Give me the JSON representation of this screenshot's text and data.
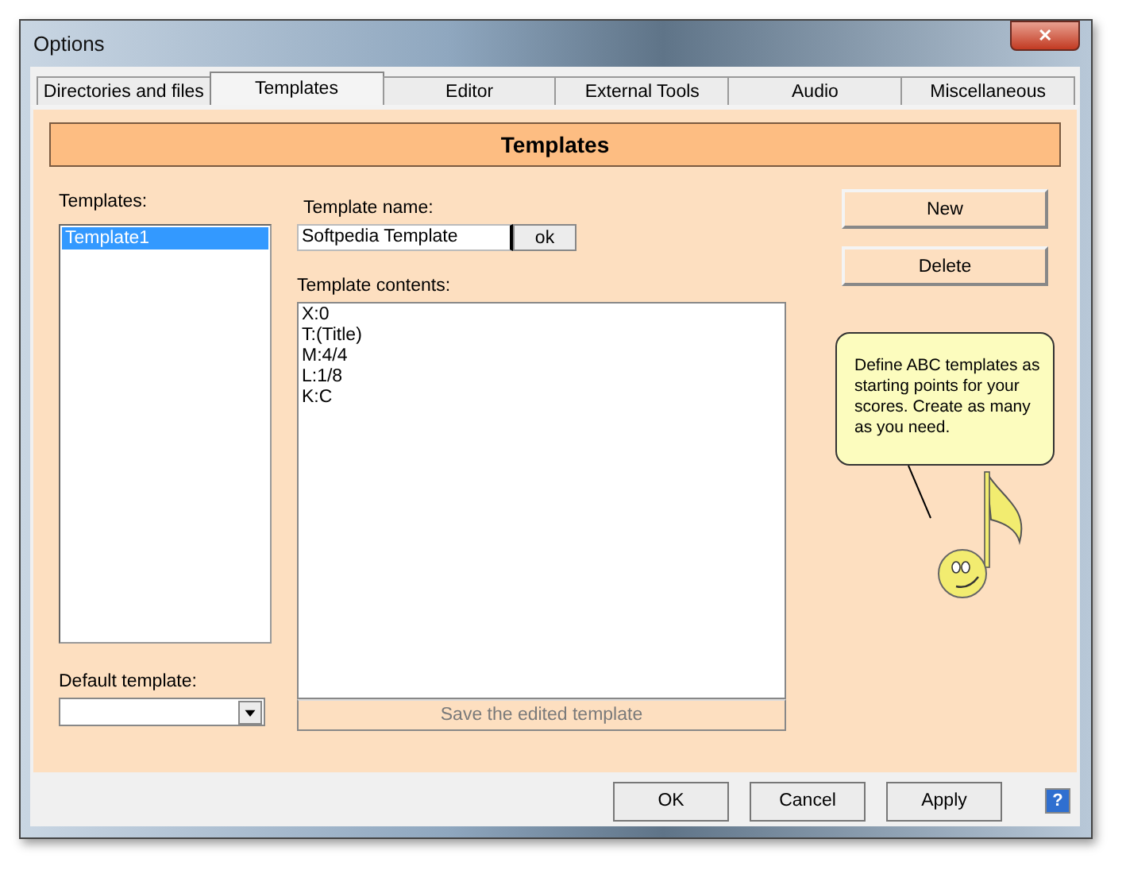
{
  "window": {
    "title": "Options",
    "close_label": "✕"
  },
  "tabs": [
    {
      "label": "Directories and files",
      "selected": false
    },
    {
      "label": "Templates",
      "selected": true
    },
    {
      "label": "Editor",
      "selected": false
    },
    {
      "label": "External Tools",
      "selected": false
    },
    {
      "label": "Audio",
      "selected": false
    },
    {
      "label": "Miscellaneous",
      "selected": false
    }
  ],
  "panel_title": "Templates",
  "templates": {
    "label": "Templates:",
    "items": [
      {
        "name": "Template1",
        "selected": true
      }
    ]
  },
  "default_template": {
    "label": "Default template:"
  },
  "template_name": {
    "label": "Template name:",
    "value": "Softpedia Template",
    "focused": true,
    "ok": "ok"
  },
  "template_contents": {
    "label": "Template contents:",
    "lines": [
      "X:0",
      "T:(Title)",
      "M:4/4",
      "L:1/8",
      "K:C"
    ]
  },
  "save_button": {
    "label": "Save the edited template",
    "disabled": true
  },
  "side_buttons": [
    "New",
    "Delete"
  ],
  "hint": "Define ABC templates as starting points for your scores. Create as many as you need.",
  "footer_buttons": [
    "OK",
    "Cancel",
    "Apply"
  ],
  "help_label": "?"
}
